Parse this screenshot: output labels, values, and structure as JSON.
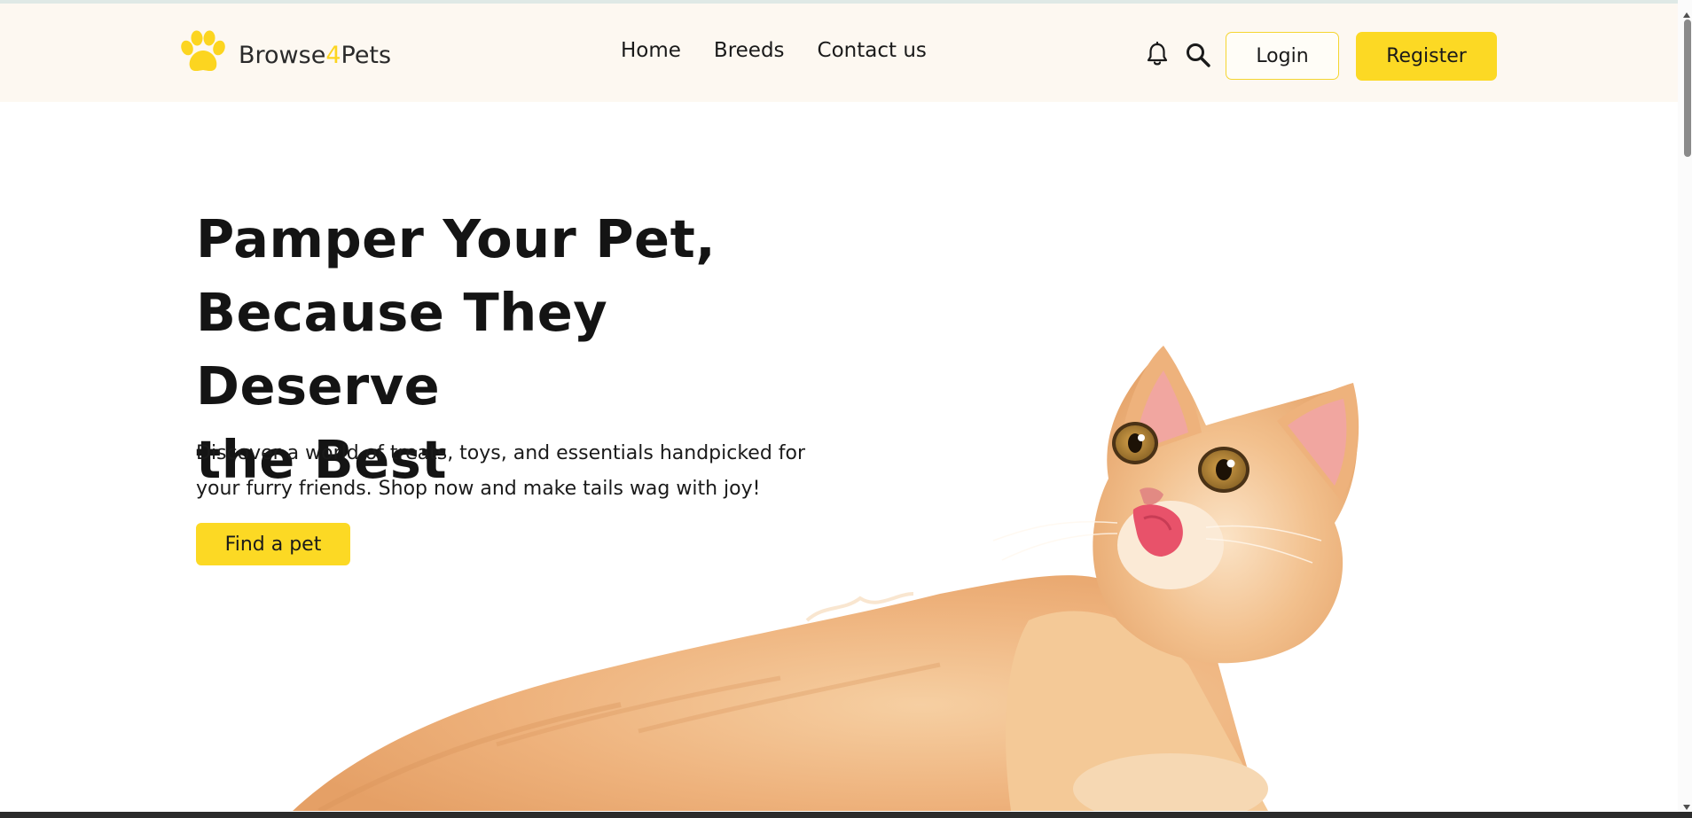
{
  "brand": {
    "prefix": "Browse",
    "accent": "4",
    "suffix": "Pets",
    "icon": "paw-icon"
  },
  "nav": {
    "links": [
      {
        "label": "Home"
      },
      {
        "label": "Breeds"
      },
      {
        "label": "Contact us"
      }
    ]
  },
  "header": {
    "bell_icon": "bell-icon",
    "search_icon": "search-icon",
    "login_label": "Login",
    "register_label": "Register"
  },
  "hero": {
    "title_line1": "Pamper Your Pet,",
    "title_line2": "Because They Deserve",
    "title_line3": "the Best",
    "text_line1": "Discover a world of treats, toys, and essentials handpicked for",
    "text_line2": "your furry friends. Shop now and make tails wag with joy!",
    "cta_label": "Find a pet"
  },
  "colors": {
    "accent": "#fcd924",
    "header_bg": "#fdf8f1",
    "text": "#1a1a1a",
    "cat_fur": "#f0b886"
  }
}
